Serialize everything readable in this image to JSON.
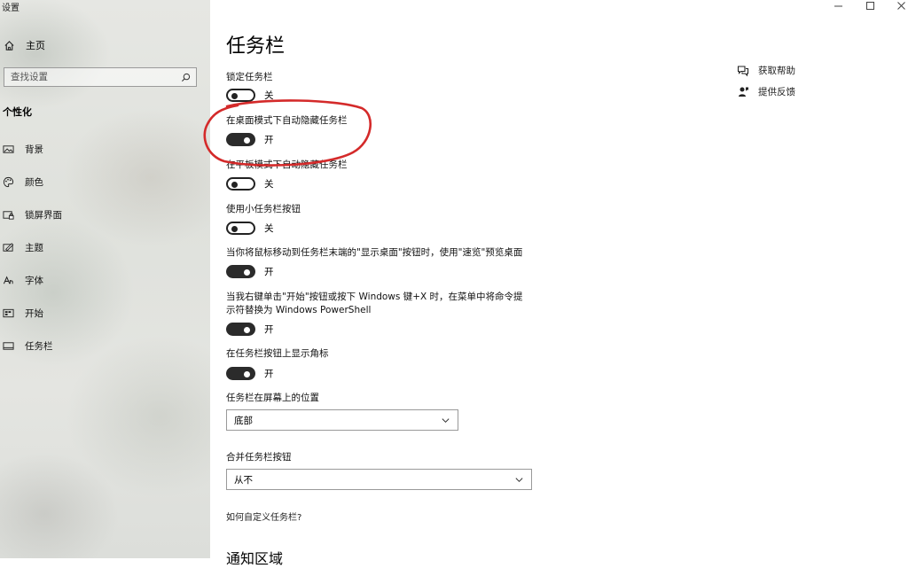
{
  "window": {
    "title": "设置",
    "controls": [
      "minimize-icon",
      "maximize-icon",
      "close-icon"
    ]
  },
  "sidebar": {
    "home_label": "主页",
    "search_placeholder": "查找设置",
    "section_label": "个性化",
    "items": [
      {
        "label": "背景",
        "icon": "picture-icon"
      },
      {
        "label": "颜色",
        "icon": "palette-icon"
      },
      {
        "label": "锁屏界面",
        "icon": "lockscreen-icon"
      },
      {
        "label": "主题",
        "icon": "theme-icon"
      },
      {
        "label": "字体",
        "icon": "font-icon"
      },
      {
        "label": "开始",
        "icon": "start-icon"
      },
      {
        "label": "任务栏",
        "icon": "taskbar-icon"
      }
    ]
  },
  "main": {
    "title": "任务栏",
    "settings": [
      {
        "label": "锁定任务栏",
        "state": "关",
        "on": false
      },
      {
        "label": "在桌面模式下自动隐藏任务栏",
        "state": "开",
        "on": true
      },
      {
        "label": "在平板模式下自动隐藏任务栏",
        "state": "关",
        "on": false
      },
      {
        "label": "使用小任务栏按钮",
        "state": "关",
        "on": false
      },
      {
        "label": "当你将鼠标移动到任务栏末端的\"显示桌面\"按钮时，使用\"速览\"预览桌面",
        "state": "开",
        "on": true
      },
      {
        "label_line1": "当我右键单击\"开始\"按钮或按下 Windows 键+X 时，在菜单中将命令提",
        "label_line2": "示符替换为 Windows PowerShell",
        "state": "开",
        "on": true
      },
      {
        "label": "在任务栏按钮上显示角标",
        "state": "开",
        "on": true
      }
    ],
    "position": {
      "label": "任务栏在屏幕上的位置",
      "value": "底部"
    },
    "combine": {
      "label": "合并任务栏按钮",
      "value": "从不"
    },
    "customize_link": "如何自定义任务栏?",
    "next_section": "通知区域"
  },
  "help": {
    "get_help": "获取帮助",
    "feedback": "提供反馈"
  },
  "annotation_color": "#d42a2a"
}
